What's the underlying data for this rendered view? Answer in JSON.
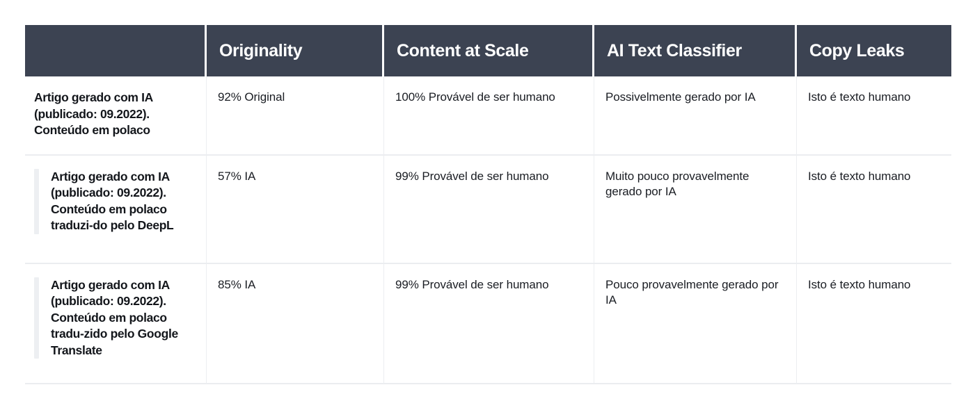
{
  "table": {
    "columns": [
      {
        "key": "sample",
        "label": ""
      },
      {
        "key": "originality",
        "label": "Originality"
      },
      {
        "key": "content_at_scale",
        "label": "Content at Scale"
      },
      {
        "key": "ai_text_classifier",
        "label": "AI Text Classifier"
      },
      {
        "key": "copy_leaks",
        "label": "Copy Leaks"
      }
    ],
    "rows": [
      {
        "accent": false,
        "sample": "Artigo gerado com IA (publicado: 09.2022). Conteúdo em polaco",
        "originality": "92% Original",
        "content_at_scale": "100% Provável de ser humano",
        "ai_text_classifier": "Possivelmente gerado por IA",
        "copy_leaks": "Isto é texto humano"
      },
      {
        "accent": true,
        "sample": "Artigo gerado com IA (publicado: 09.2022). Conteúdo em polaco traduzi-do pelo DeepL",
        "originality": "57% IA",
        "content_at_scale": "99% Provável de ser humano",
        "ai_text_classifier": "Muito pouco provavelmente gerado por IA",
        "copy_leaks": "Isto é texto humano"
      },
      {
        "accent": true,
        "sample": "Artigo gerado com IA (publicado: 09.2022). Conteúdo em polaco tradu-zido pelo Google Translate",
        "originality": "85% IA",
        "content_at_scale": "99% Provável de ser humano",
        "ai_text_classifier": "Pouco provavelmente gerado por IA",
        "copy_leaks": "Isto é texto humano"
      }
    ]
  },
  "colors": {
    "header_background": "#3c4352",
    "header_text": "#ffffff",
    "body_background": "#ffffff",
    "body_text": "#13161b",
    "grid_line": "#ebedf0",
    "accent_bar": "#edeff2"
  }
}
